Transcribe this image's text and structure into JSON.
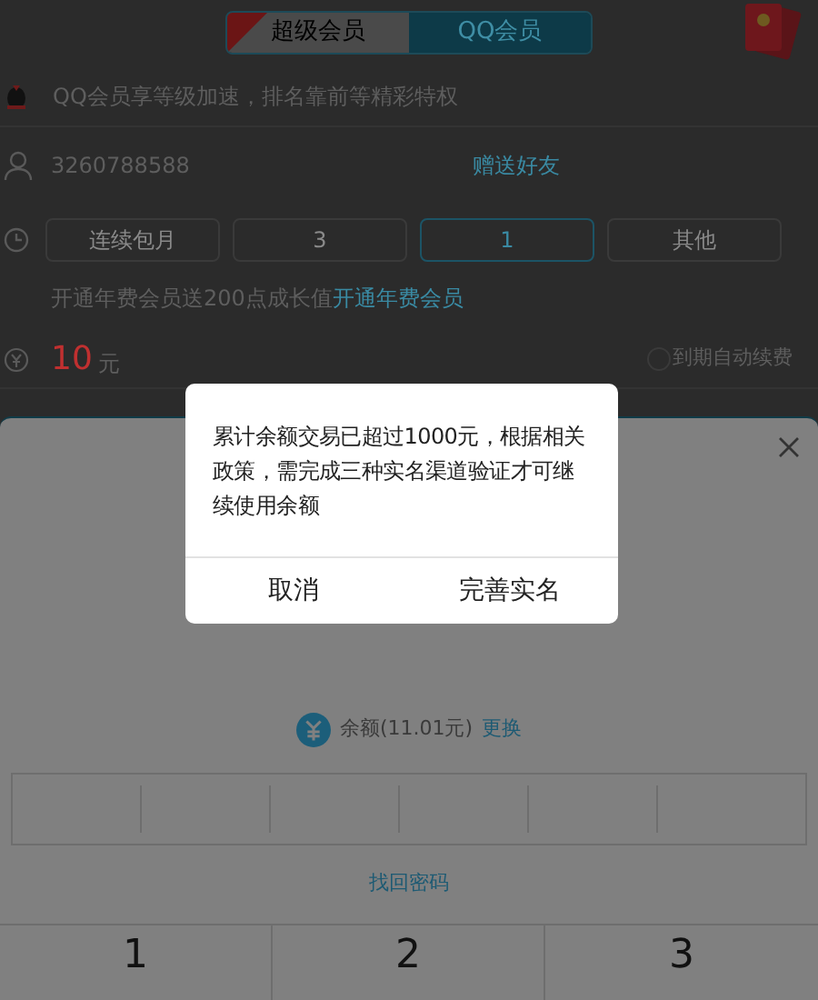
{
  "tabs": [
    {
      "label": "超级会员",
      "selected": false,
      "ribbon": true
    },
    {
      "label": "QQ会员",
      "selected": true,
      "ribbon": false
    }
  ],
  "notice": "QQ会员享等级加速，排名靠前等精彩特权",
  "account": {
    "number": "3260788588",
    "gift_link": "赠送好友"
  },
  "durations": [
    {
      "label": "连续包月",
      "selected": false
    },
    {
      "label": "3",
      "selected": false
    },
    {
      "label": "1",
      "selected": true
    },
    {
      "label": "其他",
      "selected": false
    }
  ],
  "promo": {
    "text": "开通年费会员送200点成长值",
    "link": "开通年费会员"
  },
  "price": {
    "amount": "10",
    "unit": "元"
  },
  "auto_renew": {
    "label": "到期自动续费",
    "checked": false
  },
  "payment_sheet": {
    "balance": "余额(11.01元)",
    "change_link": "更换",
    "forgot_link": "找回密码",
    "keypad": [
      "1",
      "2",
      "3"
    ]
  },
  "dialog": {
    "message": "累计余额交易已超过1000元，根据相关政策，需完成三种实名渠道验证才可继续使用余额",
    "buttons": [
      "取消",
      "完善实名"
    ]
  }
}
